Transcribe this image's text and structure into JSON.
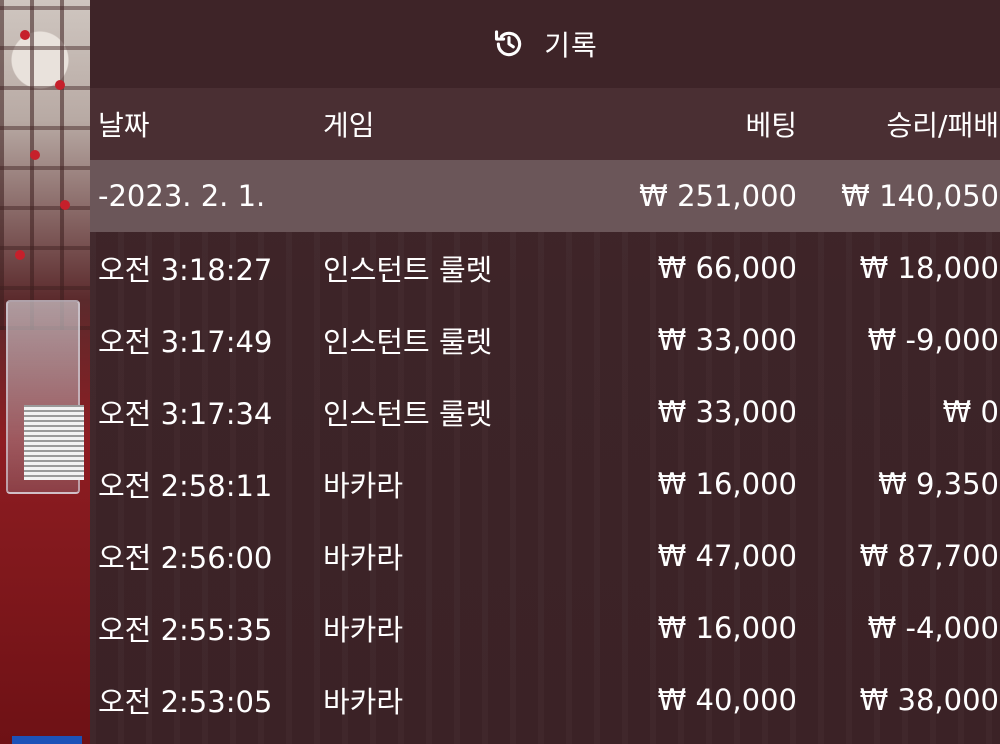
{
  "title": "기록",
  "headers": {
    "date": "날짜",
    "game": "게임",
    "bet": "베팅",
    "result": "승리/패배"
  },
  "group": {
    "date": "-2023. 2. 1.",
    "bet": "₩ 251,000",
    "result": "₩ 140,050"
  },
  "rows": [
    {
      "time": "오전 3:18:27",
      "game": "인스턴트 룰렛",
      "bet": "₩ 66,000",
      "result": "₩ 18,000"
    },
    {
      "time": "오전 3:17:49",
      "game": "인스턴트 룰렛",
      "bet": "₩ 33,000",
      "result": "₩ -9,000"
    },
    {
      "time": "오전 3:17:34",
      "game": "인스턴트 룰렛",
      "bet": "₩ 33,000",
      "result": "₩ 0"
    },
    {
      "time": "오전 2:58:11",
      "game": "바카라",
      "bet": "₩ 16,000",
      "result": "₩ 9,350"
    },
    {
      "time": "오전 2:56:00",
      "game": "바카라",
      "bet": "₩ 47,000",
      "result": "₩ 87,700"
    },
    {
      "time": "오전 2:55:35",
      "game": "바카라",
      "bet": "₩ 16,000",
      "result": "₩ -4,000"
    },
    {
      "time": "오전 2:53:05",
      "game": "바카라",
      "bet": "₩ 40,000",
      "result": "₩ 38,000"
    }
  ]
}
